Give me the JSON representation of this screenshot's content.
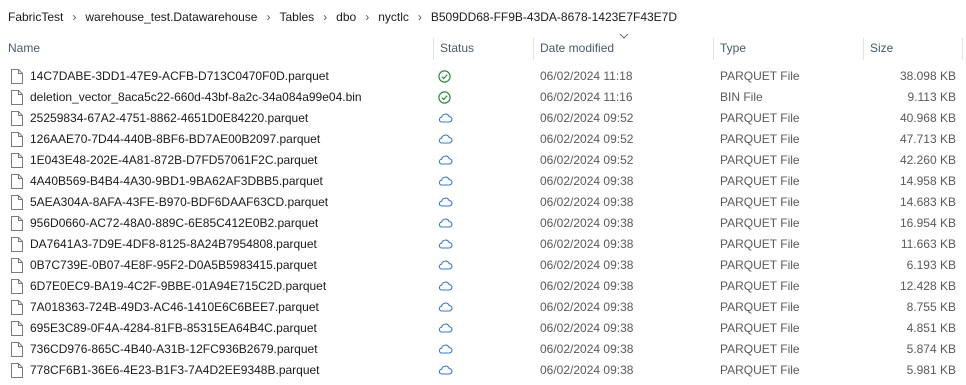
{
  "breadcrumb": [
    "FabricTest",
    "warehouse_test.Datawarehouse",
    "Tables",
    "dbo",
    "nyctlc",
    "B509DD68-FF9B-43DA-8678-1423E7F43E7D"
  ],
  "columns": {
    "name": "Name",
    "status": "Status",
    "date": "Date modified",
    "type": "Type",
    "size": "Size"
  },
  "sort": {
    "column": "date",
    "icon": "chevron-down-icon"
  },
  "colors": {
    "synced": "#2e8b3e",
    "cloud": "#3a78c4",
    "header_text": "#4c5a6a"
  },
  "files": [
    {
      "name": "14C7DABE-3DD1-47E9-ACFB-D713C0470F0D.parquet",
      "status": "synced",
      "date": "06/02/2024 11:18",
      "type": "PARQUET File",
      "size": "38.098 KB"
    },
    {
      "name": "deletion_vector_8aca5c22-660d-43bf-8a2c-34a084a99e04.bin",
      "status": "synced",
      "date": "06/02/2024 11:16",
      "type": "BIN File",
      "size": "9.113 KB"
    },
    {
      "name": "25259834-67A2-4751-8862-4651D0E84220.parquet",
      "status": "cloud",
      "date": "06/02/2024 09:52",
      "type": "PARQUET File",
      "size": "40.968 KB"
    },
    {
      "name": "126AAE70-7D44-440B-8BF6-BD7AE00B2097.parquet",
      "status": "cloud",
      "date": "06/02/2024 09:52",
      "type": "PARQUET File",
      "size": "47.713 KB"
    },
    {
      "name": "1E043E48-202E-4A81-872B-D7FD57061F2C.parquet",
      "status": "cloud",
      "date": "06/02/2024 09:52",
      "type": "PARQUET File",
      "size": "42.260 KB"
    },
    {
      "name": "4A40B569-B4B4-4A30-9BD1-9BA62AF3DBB5.parquet",
      "status": "cloud",
      "date": "06/02/2024 09:38",
      "type": "PARQUET File",
      "size": "14.958 KB"
    },
    {
      "name": "5AEA304A-8AFA-43FE-B970-BDF6DAAF63CD.parquet",
      "status": "cloud",
      "date": "06/02/2024 09:38",
      "type": "PARQUET File",
      "size": "14.683 KB"
    },
    {
      "name": "956D0660-AC72-48A0-889C-6E85C412E0B2.parquet",
      "status": "cloud",
      "date": "06/02/2024 09:38",
      "type": "PARQUET File",
      "size": "16.954 KB"
    },
    {
      "name": "DA7641A3-7D9E-4DF8-8125-8A24B7954808.parquet",
      "status": "cloud",
      "date": "06/02/2024 09:38",
      "type": "PARQUET File",
      "size": "11.663 KB"
    },
    {
      "name": "0B7C739E-0B07-4E8F-95F2-D0A5B5983415.parquet",
      "status": "cloud",
      "date": "06/02/2024 09:38",
      "type": "PARQUET File",
      "size": "6.193 KB"
    },
    {
      "name": "6D7E0EC9-BA19-4C2F-9BBE-01A94E715C2D.parquet",
      "status": "cloud",
      "date": "06/02/2024 09:38",
      "type": "PARQUET File",
      "size": "12.428 KB"
    },
    {
      "name": "7A018363-724B-49D3-AC46-1410E6C6BEE7.parquet",
      "status": "cloud",
      "date": "06/02/2024 09:38",
      "type": "PARQUET File",
      "size": "8.755 KB"
    },
    {
      "name": "695E3C89-0F4A-4284-81FB-85315EA64B4C.parquet",
      "status": "cloud",
      "date": "06/02/2024 09:38",
      "type": "PARQUET File",
      "size": "4.851 KB"
    },
    {
      "name": "736CD976-865C-4B40-A31B-12FC936B2679.parquet",
      "status": "cloud",
      "date": "06/02/2024 09:38",
      "type": "PARQUET File",
      "size": "5.874 KB"
    },
    {
      "name": "778CF6B1-36E6-4E23-B1F3-7A4D2EE9348B.parquet",
      "status": "cloud",
      "date": "06/02/2024 09:38",
      "type": "PARQUET File",
      "size": "5.981 KB"
    }
  ]
}
